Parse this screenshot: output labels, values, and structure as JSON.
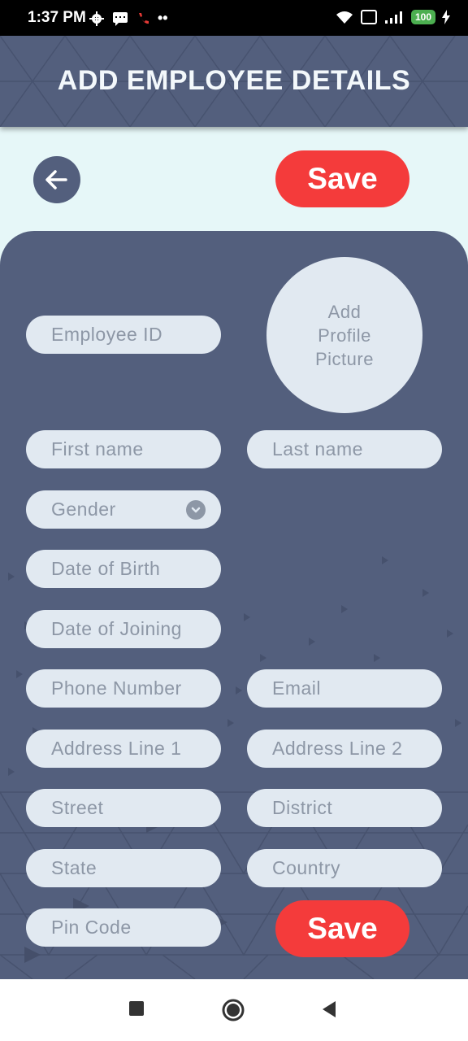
{
  "status_bar": {
    "time": "1:37 PM",
    "battery": "100"
  },
  "header": {
    "title": "ADD EMPLOYEE DETAILS"
  },
  "toolbar": {
    "save_label": "Save"
  },
  "profile": {
    "line1": "Add",
    "line2": "Profile",
    "line3": "Picture"
  },
  "fields": {
    "employee_id": "Employee ID",
    "first_name": "First name",
    "last_name": "Last name",
    "gender": "Gender",
    "dob": "Date of Birth",
    "doj": "Date of Joining",
    "phone": "Phone Number",
    "email": "Email",
    "address1": "Address Line 1",
    "address2": "Address Line 2",
    "street": "Street",
    "district": "District",
    "state": "State",
    "country": "Country",
    "pincode": "Pin Code"
  },
  "colors": {
    "primary": "#535f7d",
    "accent": "#f43b3b",
    "field_bg": "#e1e9f1",
    "page_bg": "#e6f7f8"
  }
}
